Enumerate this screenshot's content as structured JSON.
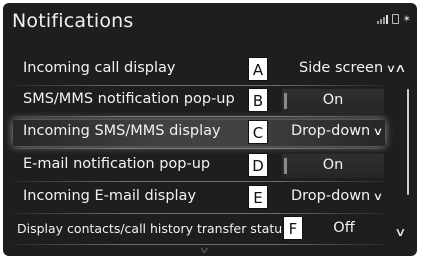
{
  "header": {
    "title": "Notifications",
    "status_icons": [
      "signal-icon",
      "battery-icon",
      "bluetooth-icon"
    ],
    "bluetooth_glyph": "✶"
  },
  "settings": [
    {
      "label": "Incoming call display",
      "callout": "A",
      "control": "dropdown",
      "value": "Side screen"
    },
    {
      "label": "SMS/MMS notification pop-up",
      "callout": "B",
      "control": "toggle",
      "value": "On"
    },
    {
      "label": "Incoming SMS/MMS display",
      "callout": "C",
      "control": "dropdown",
      "value": "Drop-down"
    },
    {
      "label": "E-mail notification pop-up",
      "callout": "D",
      "control": "toggle",
      "value": "On"
    },
    {
      "label": "Incoming E-mail display",
      "callout": "E",
      "control": "dropdown",
      "value": "Drop-down"
    },
    {
      "label": "Display contacts/call history transfer status",
      "callout": "F",
      "control": "toggle",
      "value": "Off"
    }
  ],
  "selected_row_index": 2,
  "scroll": {
    "up_glyph": "∧",
    "down_glyph": "∨"
  },
  "dropdown_glyph": "∨",
  "colors": {
    "screen_bg": "#1e1e1e",
    "text": "#f2f2f2",
    "callout_bg": "#ffffff"
  }
}
